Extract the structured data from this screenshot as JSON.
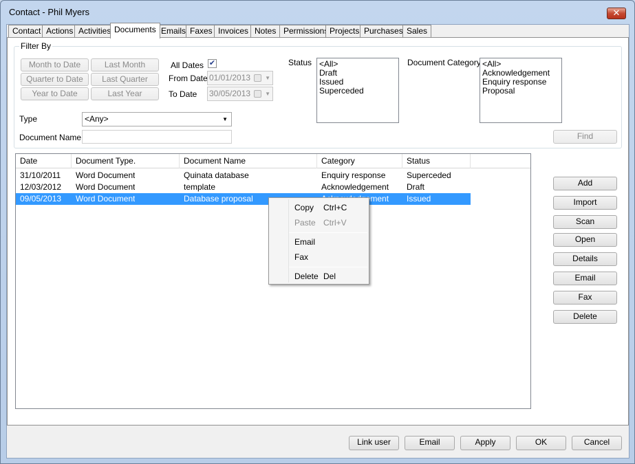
{
  "window": {
    "title": "Contact - Phil Myers",
    "close_glyph": "✕"
  },
  "tabs": [
    {
      "label": "Contact"
    },
    {
      "label": "Actions"
    },
    {
      "label": "Activities"
    },
    {
      "label": "Documents"
    },
    {
      "label": "Emails"
    },
    {
      "label": "Faxes"
    },
    {
      "label": "Invoices"
    },
    {
      "label": "Notes"
    },
    {
      "label": "Permissions"
    },
    {
      "label": "Projects"
    },
    {
      "label": "Purchases"
    },
    {
      "label": "Sales"
    }
  ],
  "active_tab": "Documents",
  "filter": {
    "group_label": "Filter By",
    "quick_buttons": {
      "month_to_date": "Month to Date",
      "last_month": "Last Month",
      "quarter_to_date": "Quarter to Date",
      "last_quarter": "Last Quarter",
      "year_to_date": "Year to Date",
      "last_year": "Last Year"
    },
    "all_dates_label": "All Dates",
    "all_dates_checked": true,
    "check_glyph": "✔",
    "from_date_label": "From Date",
    "from_date_value": "01/01/2013",
    "to_date_label": "To Date",
    "to_date_value": "30/05/2013",
    "status_label": "Status",
    "status_options": [
      "<All>",
      "Draft",
      "Issued",
      "Superceded"
    ],
    "category_label": "Document Category",
    "category_options": [
      "<All>",
      "Acknowledgement",
      "Enquiry response",
      "Proposal"
    ],
    "type_label": "Type",
    "type_value": "<Any>",
    "doc_name_label": "Document Name",
    "doc_name_value": "",
    "find_label": "Find"
  },
  "grid": {
    "columns": [
      "Date",
      "Document Type.",
      "Document Name",
      "Category",
      "Status"
    ],
    "rows": [
      {
        "date": "31/10/2011",
        "type": "Word Document",
        "name": "Quinata database",
        "category": "Enquiry response",
        "status": "Superceded",
        "selected": false
      },
      {
        "date": "12/03/2012",
        "type": "Word Document",
        "name": "template",
        "category": "Acknowledgement",
        "status": "Draft",
        "selected": false
      },
      {
        "date": "09/05/2013",
        "type": "Word Document",
        "name": "Database proposal",
        "category": "Acknowledgement",
        "status": "Issued",
        "selected": true
      }
    ]
  },
  "context_menu": {
    "items": [
      {
        "label": "Copy",
        "shortcut": "Ctrl+C",
        "enabled": true
      },
      {
        "label": "Paste",
        "shortcut": "Ctrl+V",
        "enabled": false
      },
      {
        "label": "Email",
        "shortcut": "",
        "enabled": true
      },
      {
        "label": "Fax",
        "shortcut": "",
        "enabled": true
      },
      {
        "label": "Delete",
        "shortcut": "Del",
        "enabled": true
      }
    ]
  },
  "side_buttons": {
    "add": "Add",
    "import": "Import",
    "scan": "Scan",
    "open": "Open",
    "details": "Details",
    "email": "Email",
    "fax": "Fax",
    "delete": "Delete"
  },
  "bottom_buttons": {
    "link_user": "Link user",
    "email": "Email",
    "apply": "Apply",
    "ok": "OK",
    "cancel": "Cancel"
  },
  "colors": {
    "selection": "#3399ff",
    "title_bar": "#c3d6ee",
    "close_button": "#c54a32"
  }
}
